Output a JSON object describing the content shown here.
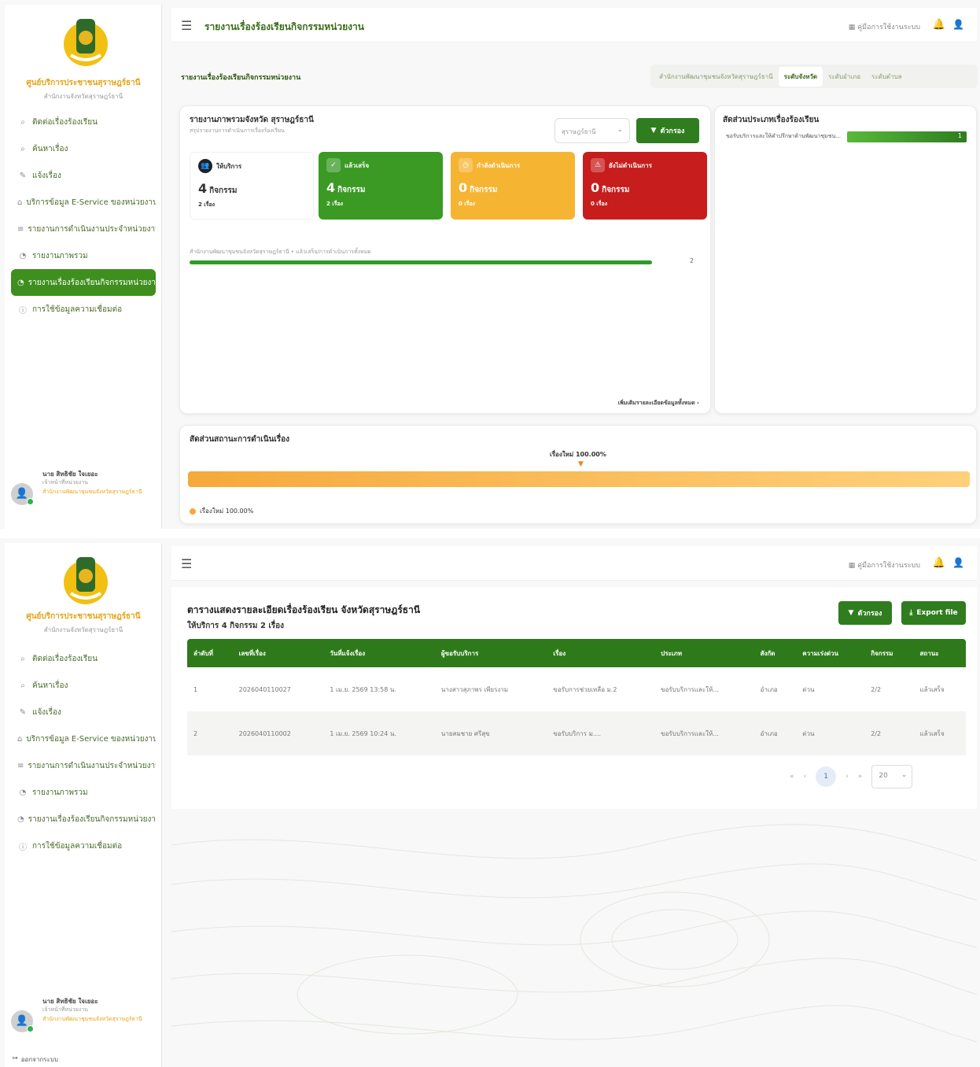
{
  "screen1": {
    "sidebar": {
      "org_name": "ศูนย์บริการประชาชนสุราษฎร์ธานี",
      "org_sub": "สำนักงานจังหวัดสุราษฎร์ธานี",
      "items": [
        {
          "label": "ติดต่อเรื่องร้องเรียน",
          "icon": "search-icon",
          "active": false
        },
        {
          "label": "ค้นหาเรื่อง",
          "icon": "search-icon",
          "active": false
        },
        {
          "label": "แจ้งเรื่อง",
          "icon": "edit-icon",
          "active": false
        },
        {
          "label": "บริการข้อมูล E-Service ของหน่วยงาน",
          "icon": "home-icon",
          "active": false
        },
        {
          "label": "รายงานการดำเนินงานประจำหน่วยงาน",
          "icon": "list-icon",
          "active": false
        },
        {
          "label": "รายงานภาพรวม",
          "icon": "chart-icon",
          "active": false
        },
        {
          "label": "รายงานเรื่องร้องเรียนกิจกรรมหน่วยงาน",
          "icon": "chart-icon",
          "active": true
        },
        {
          "label": "การใช้ข้อมูลความเชื่อมต่อ",
          "icon": "info-icon",
          "active": false
        }
      ],
      "user": {
        "name": "นาย สิทธิชัย ใจเยอะ",
        "role": "เจ้าหน้าที่หน่วยงาน",
        "org": "สำนักงานพัฒนาชุมชนจังหวัดสุราษฎร์ธานี"
      }
    },
    "topbar": {
      "title": "รายงานเรื่องร้องเรียนกิจกรรมหน่วยงาน",
      "manual": "คู่มือการใช้งานระบบ"
    },
    "section_title": "รายงานเรื่องร้องเรียนกิจกรรมหน่วยงาน",
    "tabs": [
      {
        "label": "สำนักงานพัฒนาชุมชนจังหวัดสุราษฎร์ธานี",
        "active": false
      },
      {
        "label": "ระดับจังหวัด",
        "active": true
      },
      {
        "label": "ระดับอำเภอ",
        "active": false
      },
      {
        "label": "ระดับตำบล",
        "active": false
      }
    ],
    "summary": {
      "title": "รายงานภาพรวมจังหวัด สุราษฎร์ธานี",
      "subtitle": "สรุปรายงานการดำเนินการเรื่องร้องเรียน",
      "select_value": "สุราษฎร์ธานี",
      "filter_label": "ตัวกรอง",
      "stats": [
        {
          "label": "ให้บริการ",
          "value": "4",
          "unit": "กิจกรรม",
          "sub": "2 เรื่อง",
          "style": "white",
          "icon": "user-icon"
        },
        {
          "label": "แล้วเสร็จ",
          "value": "4",
          "unit": "กิจกรรม",
          "sub": "2 เรื่อง",
          "style": "green",
          "icon": "check-icon"
        },
        {
          "label": "กำลังดำเนินการ",
          "value": "0",
          "unit": "กิจกรรม",
          "sub": "0 เรื่อง",
          "style": "yellow",
          "icon": "clock-icon"
        },
        {
          "label": "ยังไม่ดำเนินการ",
          "value": "0",
          "unit": "กิจกรรม",
          "sub": "0 เรื่อง",
          "style": "red",
          "icon": "alert-icon"
        }
      ],
      "progress_label": "สำนักงานพัฒนาชุมชนจังหวัดสุราษฎร์ธานี • แล้วเสร็จ/การดำเนินการทั้งหมด",
      "progress_value": 1.0,
      "progress_count": "2",
      "see_all": "เพิ่มเติมรายละเอียดข้อมูลทั้งหมด ›"
    },
    "type_card": {
      "title": "สัดส่วนประเภทเรื่องร้องเรียน",
      "row_label": "ขอรับบริการและให้คำปรึกษาด้านพัฒนาชุมชน...",
      "row_value": "1",
      "fraction": 1.0
    },
    "status_card": {
      "title": "สัดส่วนสถานะการดำเนินเรื่อง",
      "marker_label": "เรื่องใหม่ 100.00%",
      "legend": "เรื่องใหม่ 100.00%",
      "fraction": 1.0
    }
  },
  "screen2": {
    "sidebar": {
      "org_name": "ศูนย์บริการประชาชนสุราษฎร์ธานี",
      "org_sub": "สำนักงานจังหวัดสุราษฎร์ธานี",
      "items": [
        {
          "label": "ติดต่อเรื่องร้องเรียน",
          "icon": "search-icon"
        },
        {
          "label": "ค้นหาเรื่อง",
          "icon": "search-icon"
        },
        {
          "label": "แจ้งเรื่อง",
          "icon": "edit-icon"
        },
        {
          "label": "บริการข้อมูล E-Service ของหน่วยงาน",
          "icon": "home-icon"
        },
        {
          "label": "รายงานการดำเนินงานประจำหน่วยงาน",
          "icon": "list-icon"
        },
        {
          "label": "รายงานภาพรวม",
          "icon": "chart-icon"
        },
        {
          "label": "รายงานเรื่องร้องเรียนกิจกรรมหน่วยงาน",
          "icon": "chart-icon"
        },
        {
          "label": "การใช้ข้อมูลความเชื่อมต่อ",
          "icon": "info-icon"
        }
      ],
      "user": {
        "name": "นาย สิทธิชัย ใจเยอะ",
        "role": "เจ้าหน้าที่หน่วยงาน",
        "org": "สำนักงานพัฒนาชุมชนจังหวัดสุราษฎร์ธานี"
      },
      "logout": "ออกจากระบบ"
    },
    "topbar": {
      "manual": "คู่มือการใช้งานระบบ"
    },
    "detail": {
      "title": "ตารางแสดงรายละเอียดเรื่องร้องเรียน จังหวัดสุราษฎร์ธานี",
      "subtitle": "ให้บริการ 4 กิจกรรม 2 เรื่อง",
      "filter_label": "ตัวกรอง",
      "export_label": "Export file",
      "columns": [
        "ลำดับที่",
        "เลขที่เรื่อง",
        "วันที่แจ้งเรื่อง",
        "ผู้ขอรับบริการ",
        "เรื่อง",
        "ประเภท",
        "สังกัด",
        "ความเร่งด่วน",
        "กิจกรรม",
        "สถานะ"
      ],
      "rows": [
        [
          "1",
          "2026040110027",
          "1 เม.ย. 2569 13:58 น.",
          "นางสาวสุภาพร เพียรงาม",
          "ขอรับการช่วยเหลือ ม.2",
          "ขอรับบริการและให้...",
          "อำเภอ",
          "ด่วน",
          "2/2",
          "แล้วเสร็จ"
        ],
        [
          "2",
          "2026040110002",
          "1 เม.ย. 2569 10:24 น.",
          "นายสมชาย ศรีสุข",
          "ขอรับบริการ ม....",
          "ขอรับบริการและให้...",
          "อำเภอ",
          "ด่วน",
          "2/2",
          "แล้วเสร็จ"
        ]
      ],
      "pagination": {
        "first": "«",
        "prev": "‹",
        "page": "1",
        "next": "›",
        "last": "»",
        "page_size": "20"
      }
    }
  },
  "colors": {
    "brand_green": "#2f7d1f",
    "yellow": "#f5b533",
    "red": "#c71d1d",
    "orange_bar": "#f6a93b"
  }
}
